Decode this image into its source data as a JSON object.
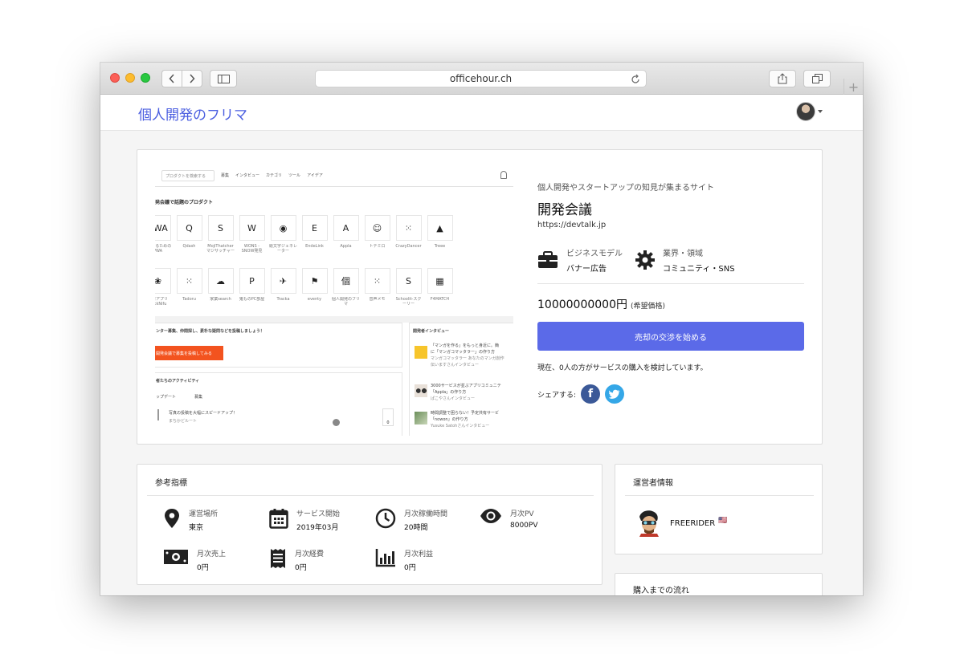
{
  "browser": {
    "url": "officehour.ch"
  },
  "site": {
    "brand": "個人開発のフリマ"
  },
  "preview": {
    "search_placeholder": "プロダクトを検索する",
    "nav": [
      "募集",
      "インタビュー",
      "カテゴリ",
      "ツール",
      "アイデア"
    ],
    "section_title": "発会議で話題のプロダクト",
    "row1": [
      {
        "icon": "PWA",
        "label": "Aを作るためのPWA"
      },
      {
        "icon": "Q",
        "label": "Qdash"
      },
      {
        "icon": "S",
        "label": "MojiThatcher マジサッチャー"
      },
      {
        "icon": "W",
        "label": "WONS - SNOW発見"
      },
      {
        "icon": "◉",
        "label": "絵文字ジェネレーター"
      },
      {
        "icon": "E",
        "label": "EndeLink"
      },
      {
        "icon": "A",
        "label": "Appla"
      },
      {
        "icon": "☺",
        "label": "トテミロ"
      },
      {
        "icon": "⁙",
        "label": "CrazyDancer"
      },
      {
        "icon": "▲",
        "label": "Treee"
      }
    ],
    "row2": [
      {
        "icon": "❀",
        "label": "文書アプリ backNifu"
      },
      {
        "icon": "⁙",
        "label": "Tadoru"
      },
      {
        "icon": "☁",
        "label": "家業search"
      },
      {
        "icon": "P",
        "label": "鬼ものPC部屋"
      },
      {
        "icon": "✈",
        "label": "Tracka"
      },
      {
        "icon": "⚑",
        "label": "eventy"
      },
      {
        "icon": "個",
        "label": "個人開発のフリマ"
      },
      {
        "icon": "⁙",
        "label": "音声メモ"
      },
      {
        "icon": "S",
        "label": "Schoolit-スクーリー"
      },
      {
        "icon": "▦",
        "label": "F4MATCH"
      }
    ],
    "recruit_title": "ンター募集、仲間探し、素朴な疑問などを投稿しましょう！",
    "recruit_button": "開発会議で募集を投稿してみる",
    "activity_title": "者たちのアクティビティ",
    "activity_cols": [
      "ップデート",
      "募集"
    ],
    "activity_item": "写真の投稿を大幅にスピードアップ！",
    "activity_sub": "まちかどルート",
    "activity_count": "0",
    "interview_title": "開発者インタビュー",
    "interviews": [
      {
        "line1": "「マンガを作る」をもっと身近に。簡",
        "line2": "に「マンガコマッタラー」の作り方",
        "line3": "マンガコマッタラー あなたのマンガ創作",
        "line4": "伝いますさんインタビュー"
      },
      {
        "line1": "3000サービスが並ぶアプリコミュニテ",
        "line2": "「Appla」の作り方",
        "line3": "ぱこやさんインタビュー",
        "line4": ""
      },
      {
        "line1": "時間調整で困らない！予定共有サービ",
        "line2": "「nowon」の作り方",
        "line3": "Yusuke Satohさんインタビュー",
        "line4": ""
      }
    ]
  },
  "project": {
    "tagline": "個人開発やスタートアップの知見が集まるサイト",
    "title": "開発会議",
    "url": "https://devtalk.jp",
    "business_label": "ビジネスモデル",
    "business_value": "バナー広告",
    "industry_label": "業界・領域",
    "industry_value": "コミュニティ・SNS",
    "price": "10000000000円",
    "price_note": "(希望価格)",
    "cta": "売却の交渉を始める",
    "consider_text": "現在、0人の方がサービスの購入を検討しています。",
    "share_label": "シェアする:"
  },
  "metrics": {
    "title": "参考指標",
    "items": [
      {
        "label": "運営場所",
        "value": "東京",
        "icon": "location-icon"
      },
      {
        "label": "サービス開始",
        "value": "2019年03月",
        "icon": "calendar-icon"
      },
      {
        "label": "月次稼働時間",
        "value": "20時間",
        "icon": "clock-icon"
      },
      {
        "label": "月次PV",
        "value": "8000PV",
        "icon": "eye-icon"
      },
      {
        "label": "月次売上",
        "value": "0円",
        "icon": "money-icon"
      },
      {
        "label": "月次経費",
        "value": "0円",
        "icon": "receipt-icon"
      },
      {
        "label": "月次利益",
        "value": "0円",
        "icon": "bar-chart-icon"
      }
    ]
  },
  "owner": {
    "title": "運営者情報",
    "name": "FREERIDER",
    "flag": "🇺🇸"
  },
  "flow": {
    "title": "購入までの流れ"
  },
  "colors": {
    "brand": "#4a5ee0",
    "cta": "#5b6ae8",
    "facebook": "#3b5998",
    "twitter": "#35a7e7",
    "recruit": "#f3531f"
  }
}
